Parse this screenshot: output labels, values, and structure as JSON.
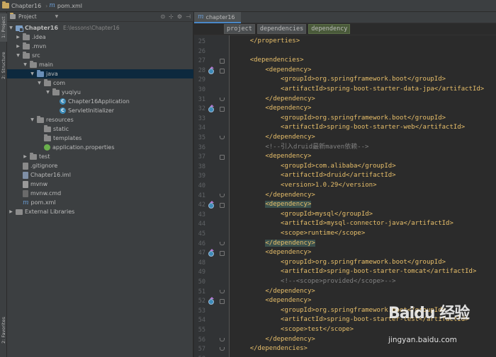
{
  "navbar": {
    "project_name": "Chapter16",
    "file_name": "pom.xml"
  },
  "tool_strip": {
    "project_tab": "1: Project",
    "structure_tab": "2: Structure",
    "favorites_tab": "2: Favorites"
  },
  "project_panel": {
    "header_label": "Project",
    "root": {
      "name": "Chapter16",
      "path": "E:\\lessons\\Chapter16"
    },
    "items": [
      {
        "name": ".idea"
      },
      {
        "name": ".mvn"
      },
      {
        "name": "src"
      },
      {
        "name": "main"
      },
      {
        "name": "java"
      },
      {
        "name": "com"
      },
      {
        "name": "yuqiyu"
      },
      {
        "name": "Chapter16Application"
      },
      {
        "name": "ServletInitializer"
      },
      {
        "name": "resources"
      },
      {
        "name": "static"
      },
      {
        "name": "templates"
      },
      {
        "name": "application.properties"
      },
      {
        "name": "test"
      },
      {
        "name": ".gitignore"
      },
      {
        "name": "Chapter16.iml"
      },
      {
        "name": "mvnw"
      },
      {
        "name": "mvnw.cmd"
      },
      {
        "name": "pom.xml"
      },
      {
        "name": "External Libraries"
      }
    ]
  },
  "editor": {
    "tab_label": "chapter16",
    "breadcrumbs": [
      "project",
      "dependencies",
      "dependency"
    ],
    "line_numbers": [
      "25",
      "26",
      "27",
      "28",
      "29",
      "30",
      "31",
      "32",
      "33",
      "34",
      "35",
      "36",
      "37",
      "38",
      "39",
      "40",
      "41",
      "42",
      "43",
      "44",
      "45",
      "46",
      "47",
      "48",
      "49",
      "50",
      "51",
      "52",
      "53",
      "54",
      "55",
      "56",
      "57",
      "58"
    ],
    "code_lines": [
      "    </properties>",
      "",
      "    <dependencies>",
      "        <dependency>",
      "            <groupId>org.springframework.boot</groupId>",
      "            <artifactId>spring-boot-starter-data-jpa</artifactId>",
      "        </dependency>",
      "        <dependency>",
      "            <groupId>org.springframework.boot</groupId>",
      "            <artifactId>spring-boot-starter-web</artifactId>",
      "        </dependency>",
      "        <!--引入druid最新maven依赖-->",
      "        <dependency>",
      "            <groupId>com.alibaba</groupId>",
      "            <artifactId>druid</artifactId>",
      "            <version>1.0.29</version>",
      "        </dependency>",
      "        <dependency>",
      "            <groupId>mysql</groupId>",
      "            <artifactId>mysql-connector-java</artifactId>",
      "            <scope>runtime</scope>",
      "        </dependency>",
      "        <dependency>",
      "            <groupId>org.springframework.boot</groupId>",
      "            <artifactId>spring-boot-starter-tomcat</artifactId>",
      "            <!--<scope>provided</scope>-->",
      "        </dependency>",
      "        <dependency>",
      "            <groupId>org.springframework.boot</groupId>",
      "            <artifactId>spring-boot-starter-test</artifactId>",
      "            <scope>test</scope>",
      "        </dependency>",
      "    </dependencies>",
      ""
    ]
  },
  "watermark": {
    "logo": "Baidu 经验",
    "url": "jingyan.baidu.com"
  },
  "colors": {
    "tag": "#e8bf6a",
    "text": "#a9b7c6",
    "comment": "#808080",
    "selection": "#0d293e"
  }
}
